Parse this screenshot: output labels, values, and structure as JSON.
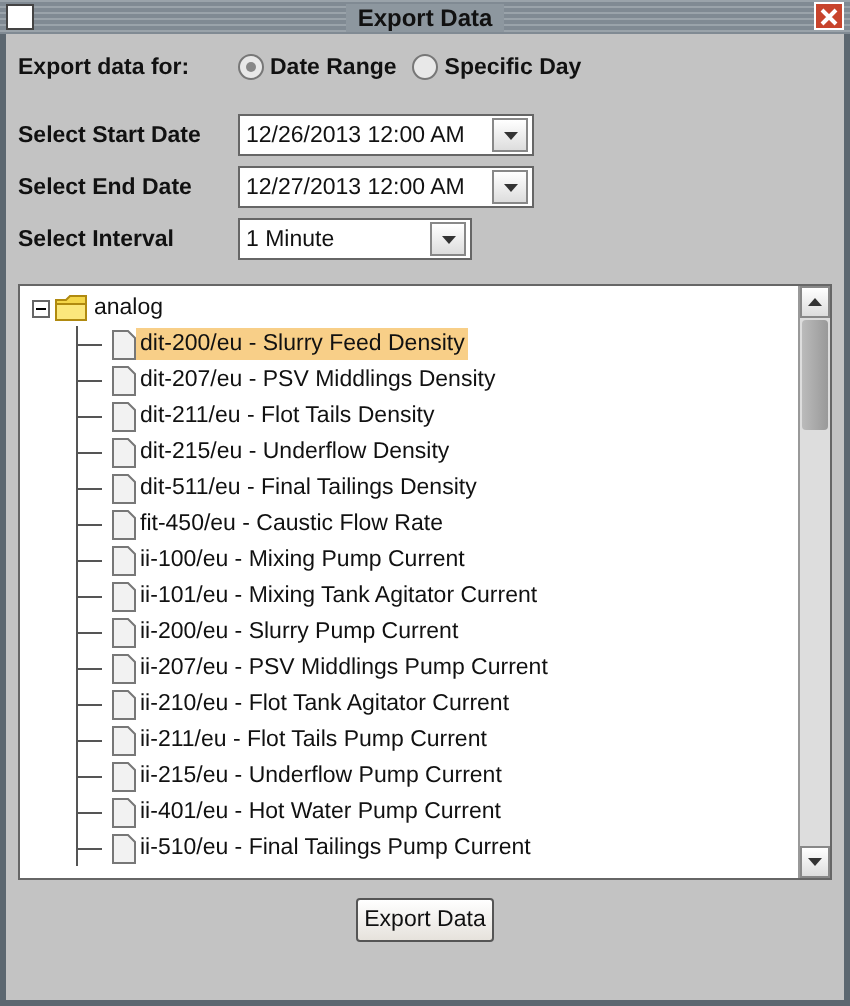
{
  "window": {
    "title": "Export Data"
  },
  "export_for": {
    "label": "Export data for:",
    "options": [
      {
        "label": "Date Range",
        "selected": true
      },
      {
        "label": "Specific Day",
        "selected": false
      }
    ]
  },
  "fields": [
    {
      "label": "Select Start Date",
      "value": "12/26/2013 12:00 AM",
      "kind": "wide"
    },
    {
      "label": "Select End Date",
      "value": "12/27/2013 12:00 AM",
      "kind": "wide"
    },
    {
      "label": "Select Interval",
      "value": "1 Minute",
      "kind": "narrow"
    }
  ],
  "tree": {
    "label": "analog",
    "expanded": true,
    "children": [
      {
        "label": "dit-200/eu - Slurry Feed Density",
        "selected": true
      },
      {
        "label": "dit-207/eu - PSV Middlings Density",
        "selected": false
      },
      {
        "label": "dit-211/eu - Flot Tails Density",
        "selected": false
      },
      {
        "label": "dit-215/eu - Underflow Density",
        "selected": false
      },
      {
        "label": "dit-511/eu - Final Tailings Density",
        "selected": false
      },
      {
        "label": "fit-450/eu - Caustic Flow Rate",
        "selected": false
      },
      {
        "label": "ii-100/eu - Mixing Pump Current",
        "selected": false
      },
      {
        "label": "ii-101/eu - Mixing Tank Agitator Current",
        "selected": false
      },
      {
        "label": "ii-200/eu - Slurry Pump Current",
        "selected": false
      },
      {
        "label": "ii-207/eu - PSV Middlings Pump Current",
        "selected": false
      },
      {
        "label": "ii-210/eu - Flot Tank Agitator Current",
        "selected": false
      },
      {
        "label": "ii-211/eu - Flot Tails Pump Current",
        "selected": false
      },
      {
        "label": "ii-215/eu - Underflow Pump Current",
        "selected": false
      },
      {
        "label": "ii-401/eu - Hot Water Pump Current",
        "selected": false
      },
      {
        "label": "ii-510/eu - Final Tailings Pump Current",
        "selected": false
      }
    ]
  },
  "buttons": [
    "Export Data"
  ]
}
